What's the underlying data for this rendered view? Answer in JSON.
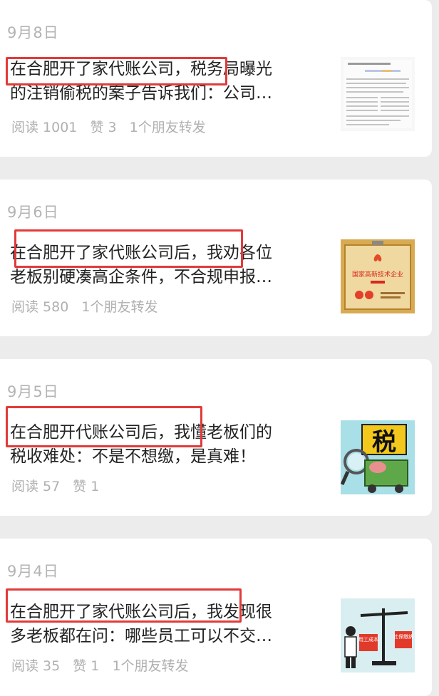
{
  "articles": [
    {
      "date": "9月8日",
      "title_line1": "在合肥开了家代账公司，税务局曝光",
      "title_line2": "的注销偷税的案子告诉我们：公司…",
      "reads": "阅读 1001",
      "likes": "赞 3",
      "shares": "1个朋友转发",
      "thumb_icon": "document-page-icon"
    },
    {
      "date": "9月6日",
      "title_line1": "在合肥开了家代账公司后，我劝各位",
      "title_line2": "老板别硬凑高企条件，不合规申报…",
      "reads": "阅读 580",
      "likes": "",
      "shares": "1个朋友转发",
      "thumb_icon": "certificate-icon",
      "thumb_text": "国家高新技术企业"
    },
    {
      "date": "9月5日",
      "title_line1": "在合肥开代账公司后，我懂老板们的",
      "title_line2": "税收难处：不是不想缴，是真难！",
      "reads": "阅读 57",
      "likes": "赞 1",
      "shares": "",
      "thumb_icon": "tax-cartoon-icon",
      "thumb_text": "税"
    },
    {
      "date": "9月4日",
      "title_line1": "在合肥开了家代账公司后，我发现很",
      "title_line2": "多老板都在问：哪些员工可以不交…",
      "reads": "阅读 35",
      "likes": "赞 1",
      "shares": "1个朋友转发",
      "thumb_icon": "balance-scale-icon",
      "thumb_text_left": "用工成本",
      "thumb_text_right": "社保缴纳"
    }
  ],
  "colors": {
    "background": "#ececec",
    "card": "#ffffff",
    "highlight": "#e23a3a",
    "meta_text": "#b0b0b0"
  }
}
